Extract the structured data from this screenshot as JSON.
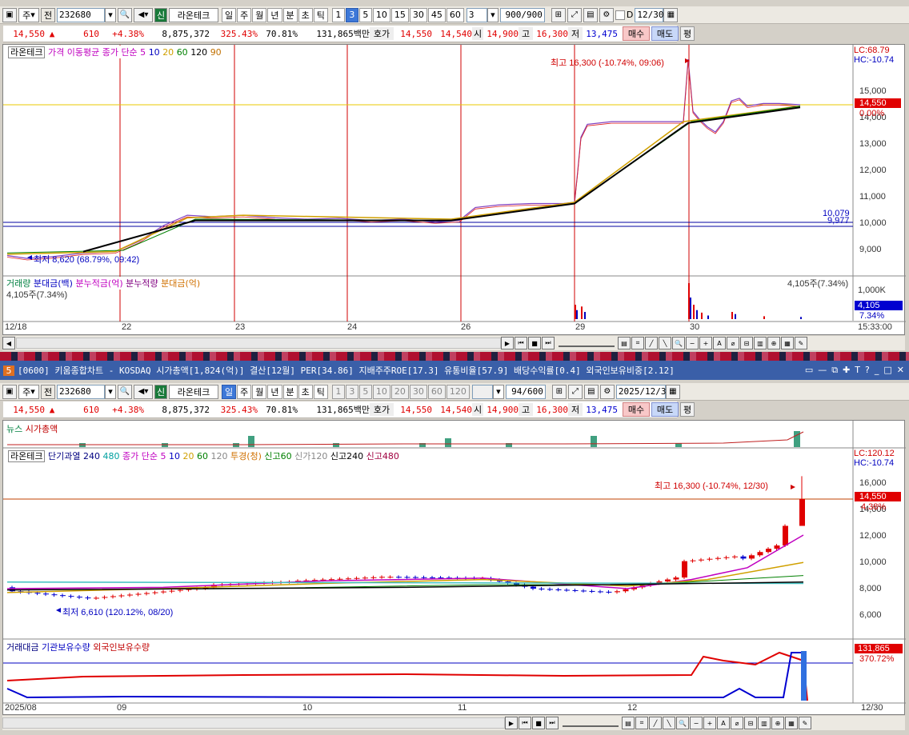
{
  "top": {
    "toolbar": {
      "mode": "주",
      "prev": "전",
      "code": "232680",
      "stock": "라온테크",
      "badge": "신",
      "periods": [
        "일",
        "주",
        "월",
        "년",
        "분",
        "초",
        "틱"
      ],
      "mins": [
        "1",
        "3",
        "5",
        "10",
        "15",
        "30",
        "45",
        "60"
      ],
      "interval": "3",
      "count": "900/900",
      "date": "12/30",
      "d_label": "D"
    },
    "quote": {
      "price": "14,550",
      "change": "610",
      "pct": "+4.38%",
      "volume": "8,875,372",
      "vol_ratio": "325.43%",
      "turnover": "70.81%",
      "amount": "131,865백만",
      "bid_lbl": "호가",
      "ask": "14,550",
      "bid": "14,540",
      "open_lbl": "시",
      "open": "14,900",
      "high_lbl": "고",
      "high": "16,300",
      "low_lbl": "저",
      "low": "13,475",
      "buy": "매수",
      "sell": "매도",
      "avg": "평"
    },
    "legend": {
      "name": "라온테크",
      "ma_title": "가격 이동평균",
      "ma_desc": "종가 단순 5",
      "ma": [
        "10",
        "20",
        "60",
        "120",
        "90"
      ]
    },
    "hi_note": "최고 16,300 (-10.74%, 09:06)",
    "lo_note": "최저 8,620 (68.79%, 09:42)",
    "lc": "LC:68.79",
    "hc": "HC:-10.74",
    "price_axis": [
      "15,000",
      "14,000",
      "13,000",
      "12,000",
      "11,000",
      "10,000",
      "9,000"
    ],
    "cur_price": "14,550",
    "cur_pct": "0.00%",
    "ref1": "10,079",
    "ref2": "9,977",
    "vol_legend": [
      "거래량",
      "분대금(백)",
      "분누적금(억)",
      "분누적량",
      "분대금(억)"
    ],
    "vol_val": "4,105주(7.34%)",
    "vol_right": "4,105주(7.34%)",
    "vol_axis": "1,000K",
    "vol_cur": "4,105",
    "vol_cur_pct": "7.34%",
    "dates": [
      "12/18",
      "22",
      "23",
      "24",
      "26",
      "29",
      "30"
    ],
    "time": "15:33:00"
  },
  "bottom": {
    "title": "[0600] 키움종합차트 - KOSDAQ 시가총액[1,824(억)] 결산[12월] PER[34.86] 지배주주ROE[17.3] 유통비율[57.9] 배당수익률[0.4] 외국인보유비중[2.12]",
    "win_no": "5",
    "toolbar": {
      "mode": "주",
      "prev": "전",
      "code": "232680",
      "stock": "라온테크",
      "badge": "신",
      "periods": [
        "일",
        "주",
        "월",
        "년",
        "분",
        "초",
        "틱"
      ],
      "mins": [
        "1",
        "3",
        "5",
        "10",
        "20",
        "30",
        "60",
        "120"
      ],
      "count": "94/600",
      "date": "2025/12/30"
    },
    "quote": {
      "price": "14,550",
      "change": "610",
      "pct": "+4.38%",
      "volume": "8,875,372",
      "vol_ratio": "325.43%",
      "turnover": "70.81%",
      "amount": "131,865백만",
      "bid_lbl": "호가",
      "ask": "14,550",
      "bid": "14,540",
      "open_lbl": "시",
      "open": "14,900",
      "high_lbl": "고",
      "high": "16,300",
      "low_lbl": "저",
      "low": "13,475",
      "buy": "매수",
      "sell": "매도",
      "avg": "평"
    },
    "news_legend": [
      "뉴스",
      "시가총액"
    ],
    "legend": {
      "name": "라온테크",
      "ind1": "단기과열",
      "ind1a": "240",
      "ind1b": "480",
      "ma_desc": "종가 단순 5",
      "ma": [
        "10",
        "20",
        "60",
        "120"
      ],
      "inv": "투경(청)",
      "n60": "신고60",
      "n120": "신가120",
      "n240": "신고240",
      "n480": "신고480"
    },
    "hi_note": "최고 16,300 (-10.74%, 12/30)",
    "lo_note": "최저 6,610 (120.12%, 08/20)",
    "lc": "LC:120.12",
    "hc": "HC:-10.74",
    "price_axis": [
      "16,000",
      "14,000",
      "12,000",
      "10,000",
      "8,000",
      "6,000"
    ],
    "cur_price": "14,550",
    "cur_pct": "4.38%",
    "sub_legend": [
      "거래대금",
      "기관보유수량",
      "외국인보유수량"
    ],
    "sub_val": "131,865",
    "sub_pct": "370.72%",
    "dates": [
      "2025/08",
      "09",
      "10",
      "11",
      "12"
    ],
    "end": "12/30"
  }
}
